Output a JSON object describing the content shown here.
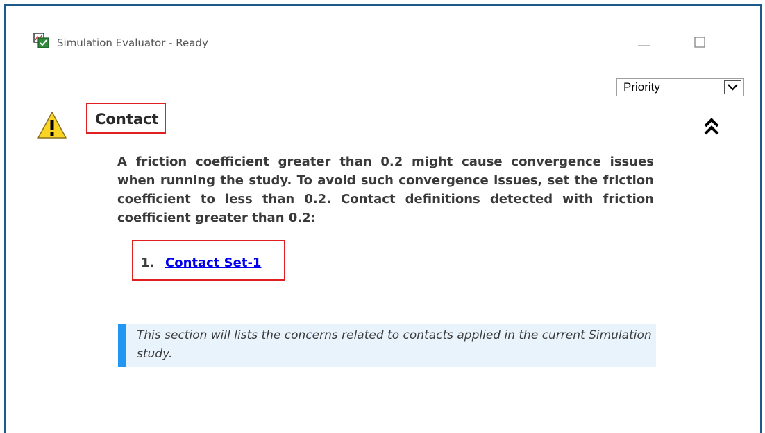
{
  "window": {
    "title": "Simulation Evaluator - Ready",
    "icons": {
      "app": "simulation-evaluator-icon",
      "minimize": "minimize-icon",
      "maximize": "maximize-icon"
    }
  },
  "sort": {
    "selected": "Priority",
    "arrow_icon": "chevron-down-icon"
  },
  "section": {
    "heading": "Contact",
    "status_icon": "warning-icon",
    "collapse_icon": "double-chevron-up-icon",
    "message": "A friction coefficient greater than 0.2 might cause convergence issues when running the study. To avoid such convergence issues, set the friction coefficient to less than 0.2. Contact definitions detected with friction coefficient greater than 0.2:",
    "items": [
      {
        "number": "1.",
        "label": "Contact Set-1"
      }
    ],
    "info": "This section will lists the concerns related to contacts applied in the current Simulation study."
  },
  "colors": {
    "window_border": "#1c5a8c",
    "highlight_box": "#e02020",
    "link": "#0000ee",
    "info_bar": "#2196f3",
    "info_background": "#e8f3fc",
    "warning_fill": "#f9d423"
  }
}
